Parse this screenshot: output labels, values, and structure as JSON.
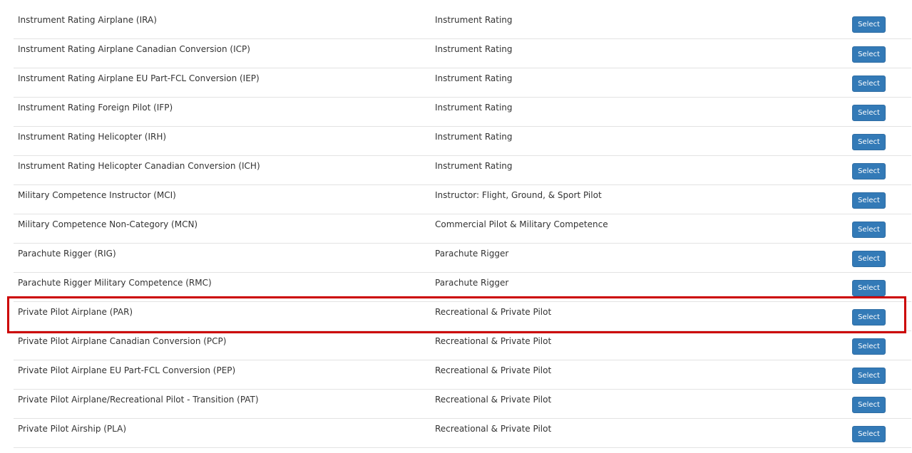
{
  "colors": {
    "button_bg": "#337ab7",
    "highlight_border": "#cc0000",
    "row_divider": "#e3e3e3"
  },
  "rows": [
    {
      "name": "Instrument Rating Airplane (IRA)",
      "category": "Instrument Rating",
      "button": "Select"
    },
    {
      "name": "Instrument Rating Airplane Canadian Conversion (ICP)",
      "category": "Instrument Rating",
      "button": "Select"
    },
    {
      "name": "Instrument Rating Airplane EU Part-FCL Conversion (IEP)",
      "category": "Instrument Rating",
      "button": "Select"
    },
    {
      "name": "Instrument Rating Foreign Pilot (IFP)",
      "category": "Instrument Rating",
      "button": "Select"
    },
    {
      "name": "Instrument Rating Helicopter (IRH)",
      "category": "Instrument Rating",
      "button": "Select"
    },
    {
      "name": "Instrument Rating Helicopter Canadian Conversion (ICH)",
      "category": "Instrument Rating",
      "button": "Select"
    },
    {
      "name": "Military Competence Instructor (MCI)",
      "category": "Instructor: Flight, Ground, & Sport Pilot",
      "button": "Select"
    },
    {
      "name": "Military Competence Non-Category (MCN)",
      "category": "Commercial Pilot & Military Competence",
      "button": "Select"
    },
    {
      "name": "Parachute Rigger (RIG)",
      "category": "Parachute Rigger",
      "button": "Select"
    },
    {
      "name": "Parachute Rigger Military Competence (RMC)",
      "category": "Parachute Rigger",
      "button": "Select"
    },
    {
      "name": "Private Pilot Airplane (PAR)",
      "category": "Recreational & Private Pilot",
      "button": "Select",
      "highlighted": true
    },
    {
      "name": "Private Pilot Airplane Canadian Conversion (PCP)",
      "category": "Recreational & Private Pilot",
      "button": "Select"
    },
    {
      "name": "Private Pilot Airplane EU Part-FCL Conversion (PEP)",
      "category": "Recreational & Private Pilot",
      "button": "Select"
    },
    {
      "name": "Private Pilot Airplane/Recreational Pilot - Transition (PAT)",
      "category": "Recreational & Private Pilot",
      "button": "Select"
    },
    {
      "name": "Private Pilot Airship (PLA)",
      "category": "Recreational & Private Pilot",
      "button": "Select"
    }
  ]
}
